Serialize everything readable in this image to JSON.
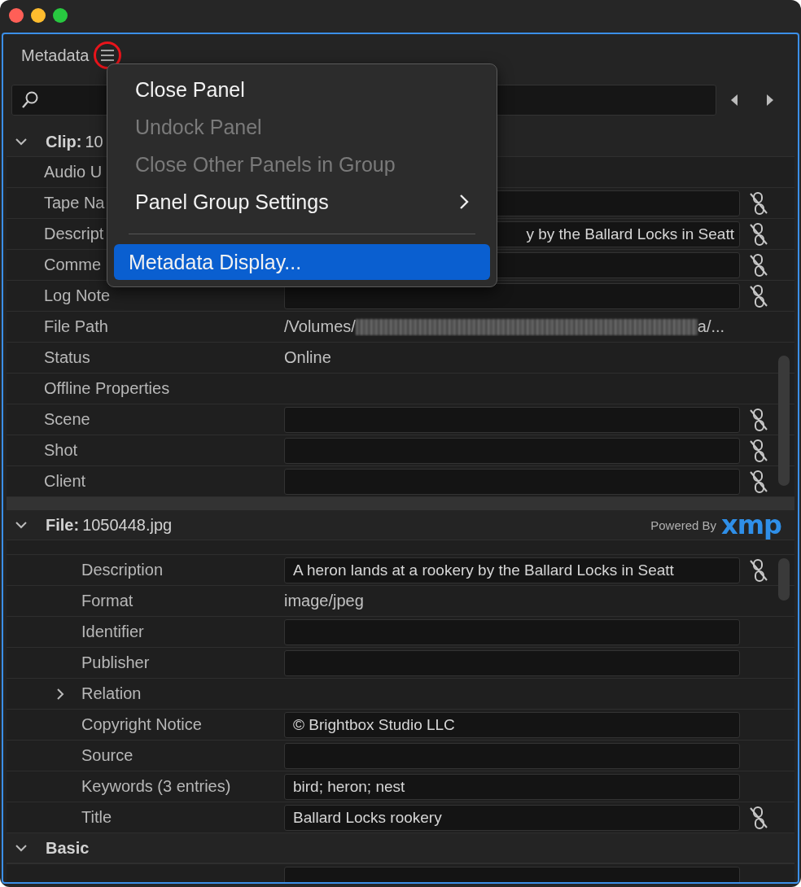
{
  "window": {
    "panel_title": "Metadata"
  },
  "menu": [
    {
      "kind": "item",
      "label": "Close Panel",
      "disabled": false,
      "selected": false,
      "submenu": false
    },
    {
      "kind": "item",
      "label": "Undock Panel",
      "disabled": true,
      "selected": false,
      "submenu": false
    },
    {
      "kind": "item",
      "label": "Close Other Panels in Group",
      "disabled": true,
      "selected": false,
      "submenu": false
    },
    {
      "kind": "item",
      "label": "Panel Group Settings",
      "disabled": false,
      "selected": false,
      "submenu": true
    },
    {
      "kind": "separator"
    },
    {
      "kind": "item",
      "label": "Metadata Display...",
      "disabled": false,
      "selected": true,
      "submenu": false
    }
  ],
  "sections": [
    {
      "title": "Clip:",
      "name": "10",
      "expanded": true,
      "rows": [
        {
          "label": "Audio U",
          "kind": "none",
          "sync_icon": false
        },
        {
          "label": "Tape Na",
          "kind": "field",
          "sync_icon": true
        },
        {
          "label": "Descript",
          "kind": "field",
          "value": "y by the Ballard Locks in Seatt",
          "partly_hidden": true,
          "sync_icon": true
        },
        {
          "label": "Comme",
          "kind": "field",
          "sync_icon": true
        },
        {
          "label": "Log Note",
          "kind": "field",
          "sync_icon": true
        },
        {
          "label": "File Path",
          "kind": "redacted",
          "value": "/Volumes/",
          "value_tail": "a/...",
          "sync_icon": false
        },
        {
          "label": "Status",
          "kind": "text",
          "value": "Online",
          "sync_icon": false
        },
        {
          "label": "Offline Properties",
          "kind": "none",
          "sync_icon": false
        },
        {
          "label": "Scene",
          "kind": "field",
          "sync_icon": true
        },
        {
          "label": "Shot",
          "kind": "field",
          "sync_icon": true
        },
        {
          "label": "Client",
          "kind": "field",
          "sync_icon": true
        }
      ]
    },
    {
      "title": "File:",
      "name": "1050448.jpg",
      "expanded": true,
      "powered_by": "Powered By",
      "logo": "xmp",
      "rows": [
        {
          "label": "Description",
          "kind": "field",
          "value": "A heron lands at a rookery by the Ballard Locks in Seatt",
          "sync_icon": true
        },
        {
          "label": "Format",
          "kind": "text",
          "value": "image/jpeg",
          "sync_icon": false
        },
        {
          "label": "Identifier",
          "kind": "field",
          "sync_icon": false
        },
        {
          "label": "Publisher",
          "kind": "field",
          "sync_icon": false
        },
        {
          "label": "Relation",
          "kind": "group",
          "expanded": false,
          "sync_icon": false
        },
        {
          "label": "Copyright Notice",
          "kind": "field",
          "value": "© Brightbox Studio LLC",
          "sync_icon": false
        },
        {
          "label": "Source",
          "kind": "field",
          "sync_icon": false
        },
        {
          "label": "Keywords (3 entries)",
          "kind": "field",
          "value": "bird; heron; nest",
          "sync_icon": false
        },
        {
          "label": "Title",
          "kind": "field",
          "value": "Ballard Locks rookery",
          "sync_icon": true
        }
      ]
    },
    {
      "title": "Basic",
      "expanded": true
    }
  ]
}
